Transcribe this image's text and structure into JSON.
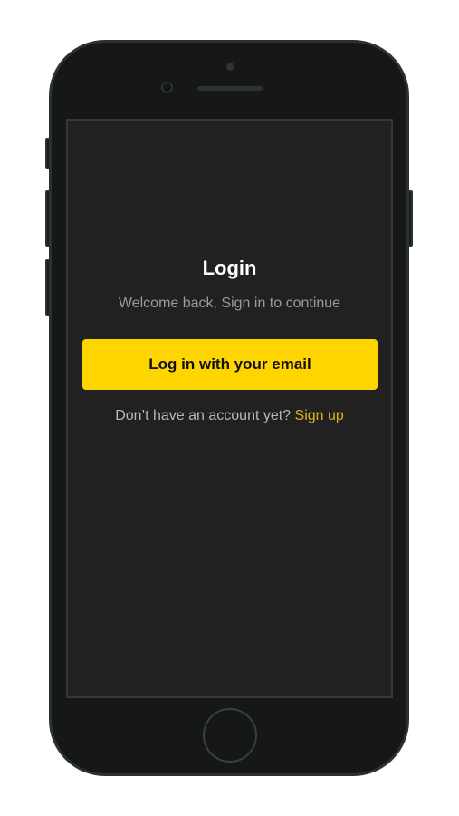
{
  "login": {
    "title": "Login",
    "subtitle": "Welcome back, Sign in to continue",
    "email_button_label": "Log in with your email",
    "no_account_text": "Don’t have an account yet?",
    "signup_label": "Sign up"
  },
  "colors": {
    "accent": "#ffd500",
    "link": "#d7b41c",
    "screen_background": "#212121",
    "device_body": "#161717"
  }
}
